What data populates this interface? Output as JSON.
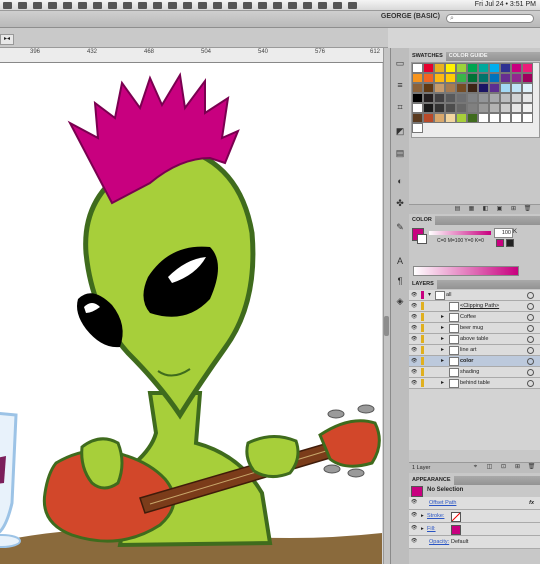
{
  "menubar": {
    "clock": "Fri Jul 24 • 3:51 PM"
  },
  "appbar": {
    "workspace": "GEORGE (BASIC)",
    "search_icon": "⌕"
  },
  "ruler": {
    "labels": [
      "396",
      "432",
      "468",
      "504",
      "540",
      "576",
      "612"
    ]
  },
  "panel_swatches": {
    "tabs": [
      "SWATCHES",
      "COLOR GUIDE"
    ]
  },
  "panel_color": {
    "tab": "COLOR",
    "k_value": "100",
    "k_label": "K",
    "cmyk_readout": "C=0 M=100 Y=0 K=0"
  },
  "panel_layers": {
    "tab": "LAYERS",
    "footer": "1 Layer",
    "layers": [
      {
        "name": "all",
        "indent": 0,
        "selected": false
      },
      {
        "name": "<Clipping Path>",
        "indent": 1,
        "selected": false
      },
      {
        "name": "Coffee",
        "indent": 1,
        "selected": false
      },
      {
        "name": "beer mug",
        "indent": 1,
        "selected": false
      },
      {
        "name": "above table",
        "indent": 1,
        "selected": false
      },
      {
        "name": "line art",
        "indent": 1,
        "selected": false
      },
      {
        "name": "color",
        "indent": 1,
        "selected": true
      },
      {
        "name": "shading",
        "indent": 1,
        "selected": false
      },
      {
        "name": "behind table",
        "indent": 1,
        "selected": false
      }
    ]
  },
  "panel_appearance": {
    "tab": "APPEARANCE",
    "selection": "No Selection",
    "offset_path": "Offset Path",
    "stroke": "Stroke:",
    "fill": "Fill:",
    "opacity": "Opacity:",
    "opacity_value": "Default",
    "fx": "fx"
  },
  "colors": {
    "magenta": "#c8007f",
    "alien_green": "#a7cf3a",
    "dark_green": "#3f6b1d",
    "guitar_red": "#d2472a",
    "table_brown": "#8a6a3c"
  }
}
